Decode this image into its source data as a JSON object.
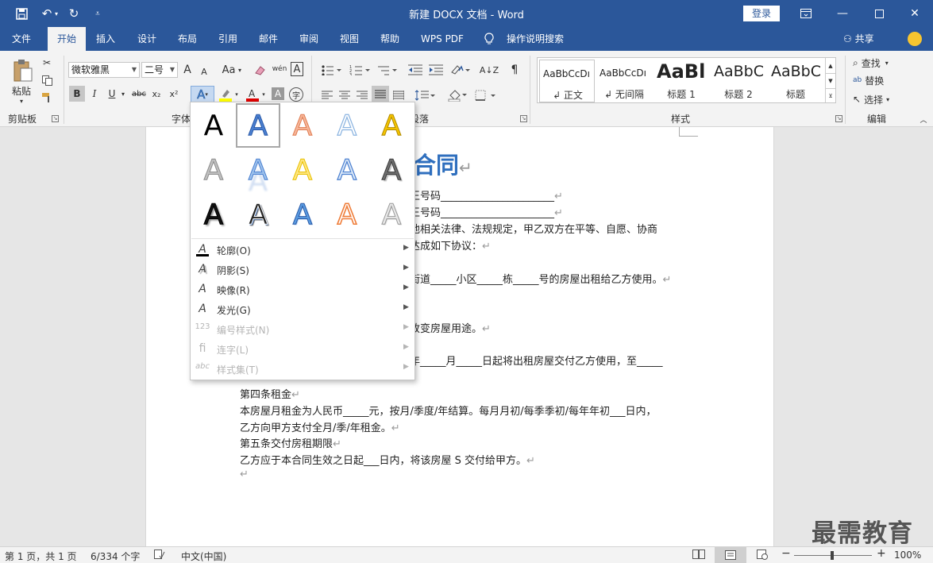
{
  "window": {
    "title": "新建 DOCX 文档 - Word",
    "login_label": "登录",
    "qa_save_icon": "save-icon",
    "qa_undo_icon": "undo-icon",
    "qa_redo_icon": "redo-icon"
  },
  "tabs": [
    "文件",
    "开始",
    "插入",
    "设计",
    "布局",
    "引用",
    "邮件",
    "审阅",
    "视图",
    "帮助",
    "WPS PDF",
    "操作说明搜索"
  ],
  "active_tab": "开始",
  "share_label": "共享",
  "ribbon": {
    "clipboard": {
      "paste_label": "粘贴",
      "group_label": "剪贴板"
    },
    "font": {
      "font_name": "微软雅黑",
      "font_size": "二号",
      "group_label": "字体",
      "bold": "B",
      "italic": "I",
      "underline": "U",
      "strike": "abc",
      "sub": "x₂",
      "sup": "x²",
      "grow": "A",
      "shrink": "A",
      "change_case": "Aa",
      "phonetic": "wén",
      "border_char": "A"
    },
    "paragraph": {
      "group_label": "段落"
    },
    "styles": {
      "group_label": "样式",
      "items": [
        {
          "sample": "AaBbCcDı",
          "name": "↲ 正文"
        },
        {
          "sample": "AaBbCcDı",
          "name": "↲ 无间隔"
        },
        {
          "sample": "AaBl",
          "name": "标题 1"
        },
        {
          "sample": "AaBbC",
          "name": "标题 2"
        },
        {
          "sample": "AaBbC",
          "name": "标题"
        }
      ]
    },
    "editing": {
      "find_label": "查找",
      "replace_label": "替换",
      "select_label": "选择",
      "group_label": "编辑"
    }
  },
  "text_effects_menu": {
    "effect_glyph": "A",
    "menu_items": [
      {
        "label": "轮廓(O)",
        "icon": "outline-icon",
        "enabled": true
      },
      {
        "label": "阴影(S)",
        "icon": "shadow-icon",
        "enabled": true
      },
      {
        "label": "映像(R)",
        "icon": "reflection-icon",
        "enabled": true
      },
      {
        "label": "发光(G)",
        "icon": "glow-icon",
        "enabled": true
      },
      {
        "label": "编号样式(N)",
        "icon": "number-style-icon",
        "enabled": false
      },
      {
        "label": "连字(L)",
        "icon": "ligature-icon",
        "enabled": false
      },
      {
        "label": "样式集(T)",
        "icon": "stylistic-set-icon",
        "enabled": false
      }
    ]
  },
  "document": {
    "title": "合同",
    "lines": [
      "王号码______________________",
      "王号码______________________",
      "他相关法律、法规规定，甲乙双方在平等、自愿、协商",
      "达成如下协议：",
      "街道_____小区_____栋_____号的房屋出租给乙方使用。",
      "改变房屋用途。",
      "年_____月_____日起将出租房屋交付乙方使用，至_____",
      "第四条租金",
      "本房屋月租金为人民币_____元，按月/季度/年结算。每月月初/每季季初/每年年初___日内，",
      "乙方向甲方支付全月/季/年租金。",
      "第五条交付房租期限",
      "乙方应于本合同生效之日起___日内，将该房屋 S 交付给甲方。"
    ],
    "paragraph_mark": "↵"
  },
  "watermark": "最需教育",
  "status": {
    "page": "第 1 页，共 1 页",
    "words": "6/334 个字",
    "language": "中文(中国)",
    "zoom": "100%",
    "zoom_minus": "−",
    "zoom_plus": "+"
  }
}
